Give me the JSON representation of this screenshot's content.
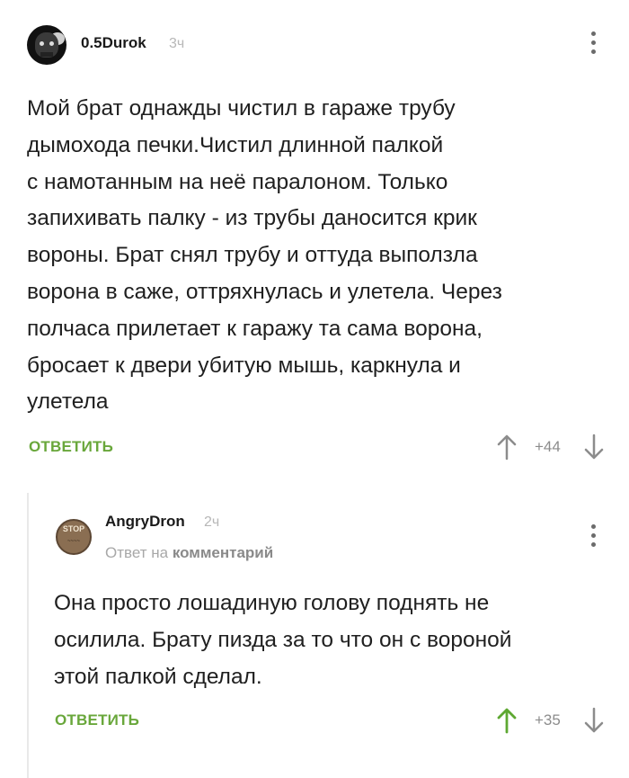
{
  "comments": [
    {
      "username": "0.5Durok",
      "time": "3ч",
      "text_lines": [
        "Мой брат однажды чистил в гараже трубу",
        "дымохода печки.Чистил длинной палкой",
        "с намотанным на неё паралоном. Только",
        "запихивать палку - из трубы даносится крик",
        "вороны. Брат снял трубу и оттуда выползла",
        "ворона в саже, оттряхнулась и улетела. Через",
        "полчаса прилетает к гаражу та сама ворона,",
        "бросает к двери убитую мышь, каркнула и",
        "улетела"
      ],
      "reply_label": "ОТВЕТИТЬ",
      "score": "+44"
    },
    {
      "username": "AngryDron",
      "time": "2ч",
      "reply_to_prefix": "Ответ на",
      "reply_to_link": "комментарий",
      "avatar_text": "STOP",
      "text_lines": [
        "Она просто лошадиную голову поднять не",
        "осилила. Брату пизда за то что он с вороной",
        "этой палкой сделал."
      ],
      "reply_label": "ОТВЕТИТЬ",
      "score": "+35"
    }
  ],
  "colors": {
    "accent_green": "#69a73b",
    "muted": "#8c8c8c",
    "upvoted": "#5ea832"
  },
  "icons": [
    "more-vertical-icon",
    "upvote-arrow-icon",
    "downvote-arrow-icon"
  ]
}
